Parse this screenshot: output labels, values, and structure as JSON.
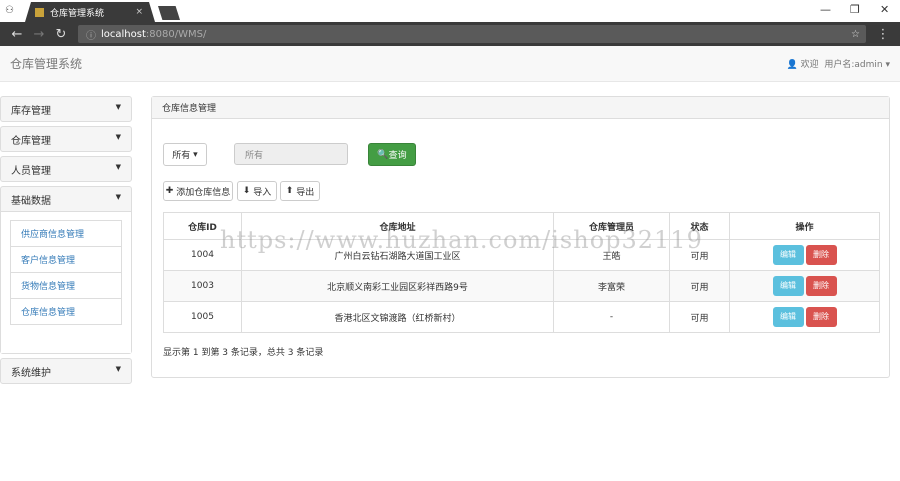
{
  "browser": {
    "tab_title": "仓库管理系统",
    "url_host": "localhost",
    "url_rest": ":8080/WMS/"
  },
  "header": {
    "brand": "仓库管理系统",
    "welcome": "欢迎",
    "user": "用户名:admin"
  },
  "sidebar": {
    "groups": [
      {
        "label": "库存管理"
      },
      {
        "label": "仓库管理"
      },
      {
        "label": "人员管理"
      },
      {
        "label": "基础数据",
        "items": [
          "供应商信息管理",
          "客户信息管理",
          "货物信息管理",
          "仓库信息管理"
        ]
      },
      {
        "label": "系统维护"
      }
    ]
  },
  "panel": {
    "title": "仓库信息管理",
    "filter_select": "所有",
    "filter_input_placeholder": "所有",
    "search_label": "查询",
    "add_label": "添加仓库信息",
    "import_label": "导入",
    "export_label": "导出"
  },
  "table": {
    "headers": [
      "仓库ID",
      "仓库地址",
      "仓库管理员",
      "状态",
      "操作"
    ],
    "rows": [
      {
        "id": "1004",
        "address": "广州白云钻石湖路大道国工业区",
        "manager": "王皓",
        "status": "可用"
      },
      {
        "id": "1003",
        "address": "北京顺义南彩工业园区彩祥西路9号",
        "manager": "李富荣",
        "status": "可用"
      },
      {
        "id": "1005",
        "address": "香港北区文锦渡路（红桥新村）",
        "manager": "-",
        "status": "可用"
      }
    ],
    "edit_label": "编辑",
    "delete_label": "删除"
  },
  "pagination": "显示第 1 到第 3 条记录，总共 3 条记录",
  "watermark": "https://www.huzhan.com/ishop32119",
  "colors": {
    "success": "#449d44",
    "info": "#5bc0de",
    "danger": "#d9534f",
    "link": "#337ab7"
  }
}
